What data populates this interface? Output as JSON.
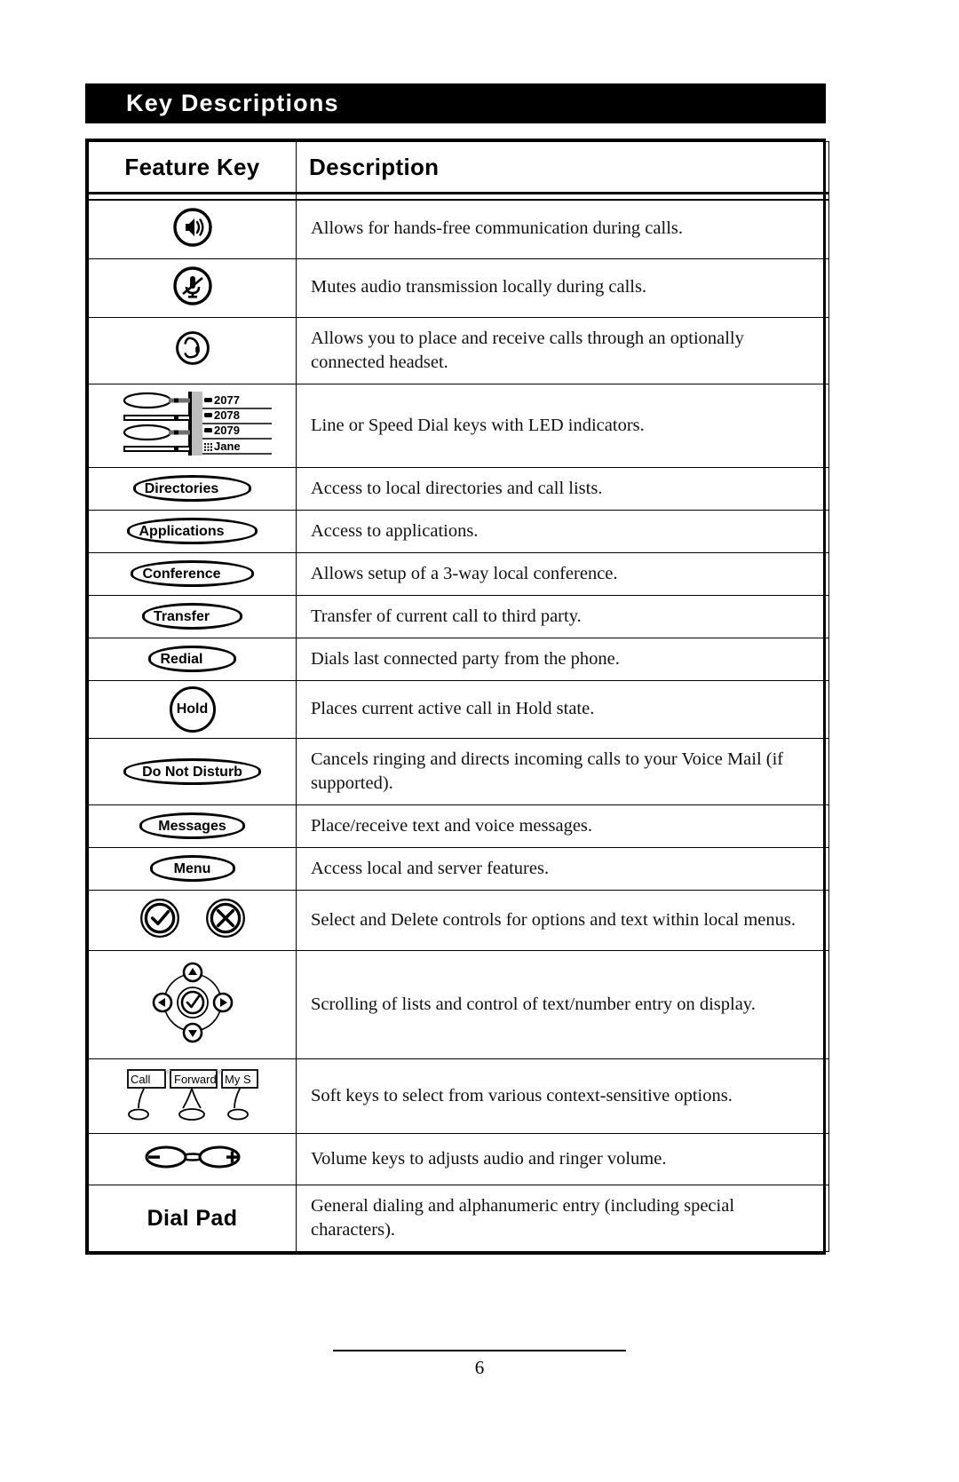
{
  "banner": {
    "title": "Key Descriptions"
  },
  "table": {
    "headers": {
      "feature_key": "Feature Key",
      "description": "Description"
    },
    "rows": [
      {
        "key_icon": "speaker-icon",
        "key_label": "",
        "description": "Allows for hands-free communication during calls."
      },
      {
        "key_icon": "mute-microphone-icon",
        "key_label": "",
        "description": "Mutes audio transmission locally during calls."
      },
      {
        "key_icon": "headset-icon",
        "key_label": "",
        "description": "Allows you to place and receive calls through an optionally connected headset."
      },
      {
        "key_icon": "line-keys-illustration",
        "key_label": "",
        "description": "Line or Speed Dial keys with LED indicators."
      },
      {
        "key_icon": "barrel-key",
        "key_label": "Directories",
        "description": "Access to local directories and call lists."
      },
      {
        "key_icon": "barrel-key",
        "key_label": "Applications",
        "description": "Access to applications."
      },
      {
        "key_icon": "barrel-key",
        "key_label": "Conference",
        "description": "Allows setup of a 3-way local conference."
      },
      {
        "key_icon": "barrel-key",
        "key_label": "Transfer",
        "description": "Transfer of current call to third party."
      },
      {
        "key_icon": "barrel-key",
        "key_label": "Redial",
        "description": "Dials last connected party from the phone."
      },
      {
        "key_icon": "round-key",
        "key_label": "Hold",
        "description": "Places current active call in Hold state."
      },
      {
        "key_icon": "barrel-key",
        "key_label": "Do Not Disturb",
        "description": "Cancels ringing and directs incoming calls to your Voice Mail (if supported)."
      },
      {
        "key_icon": "barrel-key",
        "key_label": "Messages",
        "description": "Place/receive text and voice messages."
      },
      {
        "key_icon": "barrel-key",
        "key_label": "Menu",
        "description": "Access local and server features."
      },
      {
        "key_icon": "select-delete-icons",
        "key_label": "",
        "description": "Select and Delete controls for options and text within local menus."
      },
      {
        "key_icon": "navigation-cluster-icon",
        "key_label": "",
        "description": "Scrolling of lists and control of text/number entry on display."
      },
      {
        "key_icon": "soft-keys-illustration",
        "key_label": "",
        "description": "Soft keys to select from various context-sensitive options."
      },
      {
        "key_icon": "volume-rocker-icon",
        "key_label": "",
        "description": "Volume keys to adjusts audio and ringer volume."
      },
      {
        "key_icon": "",
        "key_label": "Dial Pad",
        "description": "General dialing and alphanumeric entry (including special characters)."
      }
    ]
  },
  "line_keys": {
    "entries": [
      {
        "label": "2077",
        "has_phone_glyph": true
      },
      {
        "label": "2078",
        "has_phone_glyph": true
      },
      {
        "label": "2079",
        "has_phone_glyph": true
      },
      {
        "label": "Jane",
        "has_phone_glyph": false
      }
    ]
  },
  "soft_keys": {
    "labels": [
      "Call",
      "Forward",
      "My S"
    ]
  },
  "volume": {
    "minus": "–",
    "plus": "+"
  },
  "footer": {
    "page_number": "6"
  },
  "colors": {
    "banner_bg": "#000000",
    "banner_text": "#ffffff",
    "rule": "#000000",
    "text": "#111111"
  }
}
